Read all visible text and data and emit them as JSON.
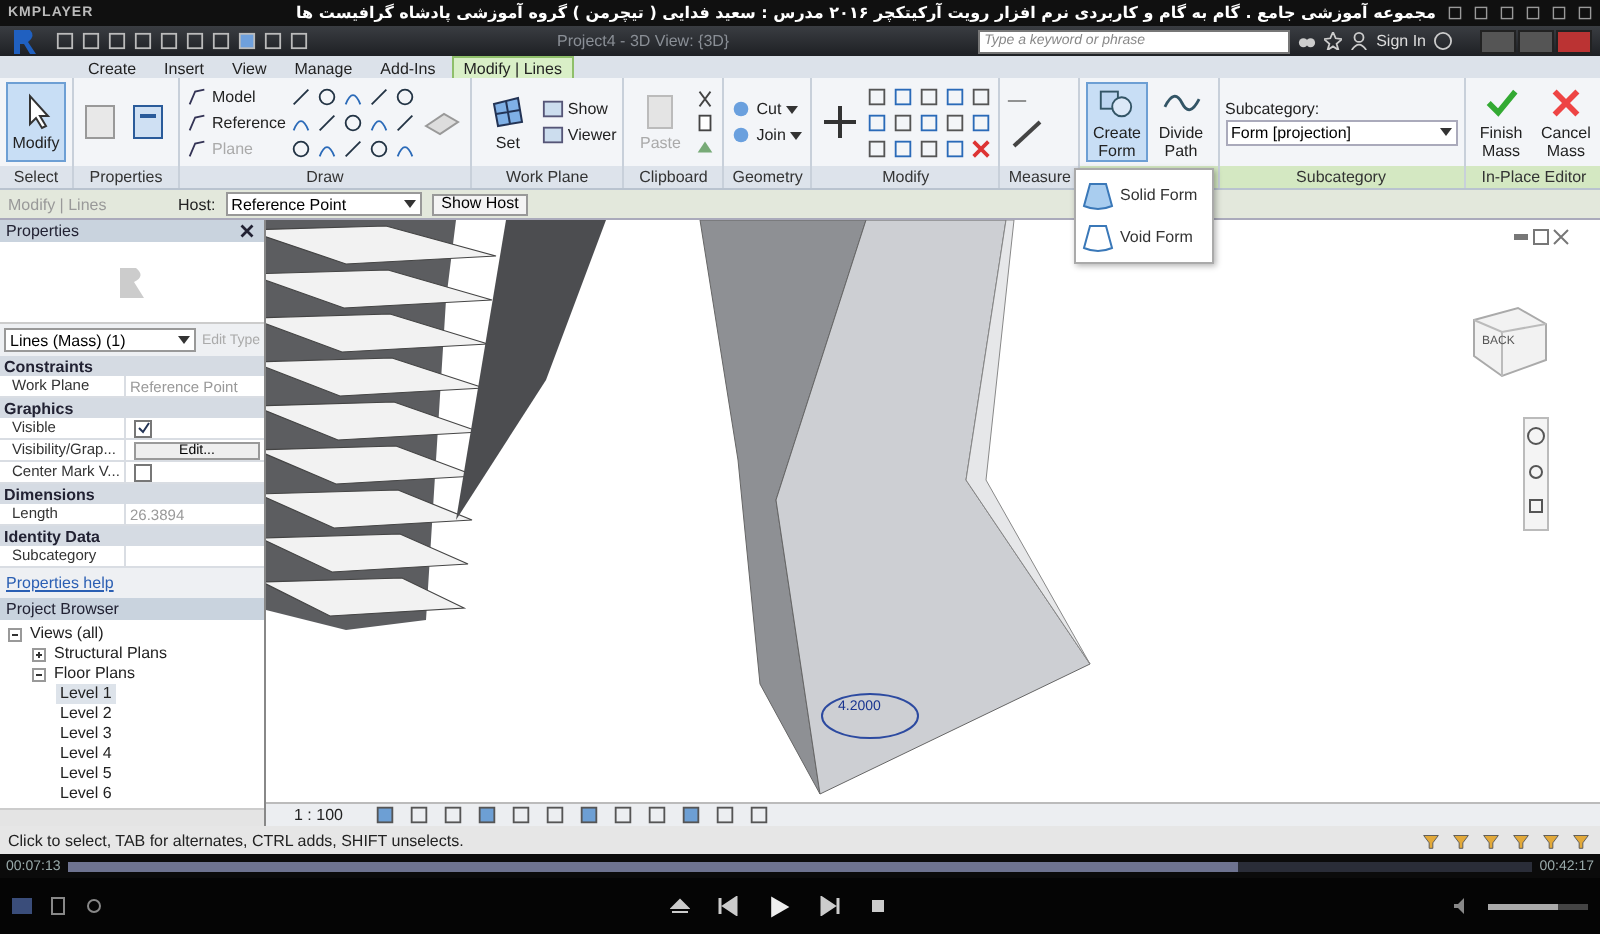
{
  "player": {
    "brand": "KMPLAYER",
    "title": "مجموعه آموزشی جامع . گام به گام و کاربردی نرم افزار رویت آرکیتکچر ۲۰۱۶   مدرس : سعید فدایی ( تیچرمن ) گروه آموزشی پادشاه گرافیست ها",
    "elapsed": "00:07:13",
    "total": "00:42:17",
    "level": 0.8,
    "volume": {
      "level": 0.7
    }
  },
  "app": {
    "title": "Project4 - 3D View: {3D}",
    "search_placeholder": "Type a keyword or phrase",
    "sign_in": "Sign In"
  },
  "tabs": [
    {
      "label": "Create",
      "selected": false
    },
    {
      "label": "Insert",
      "selected": false
    },
    {
      "label": "View",
      "selected": false
    },
    {
      "label": "Manage",
      "selected": false
    },
    {
      "label": "Add-Ins",
      "selected": false
    },
    {
      "label": "Modify | Lines",
      "selected": true
    }
  ],
  "ribbon": [
    {
      "kind": "select",
      "label": "Select",
      "buttons": [
        {
          "label": "Modify",
          "selected": true
        }
      ]
    },
    {
      "kind": "properties",
      "label": "Properties"
    },
    {
      "kind": "draw",
      "label": "Draw",
      "buttons": [
        {
          "label": "Model",
          "disabled": false
        },
        {
          "label": "Reference",
          "disabled": false
        },
        {
          "label": "Plane",
          "disabled": true
        }
      ]
    },
    {
      "kind": "work_plane",
      "label": "Work Plane",
      "buttons": [
        {
          "label": "Set"
        },
        {
          "label": "Show"
        },
        {
          "label": "Viewer"
        }
      ]
    },
    {
      "kind": "clipboard",
      "label": "Clipboard",
      "buttons": [
        {
          "label": "Paste",
          "disabled": true
        }
      ]
    },
    {
      "kind": "geometry",
      "label": "Geometry",
      "buttons": [
        {
          "label": "Cut"
        },
        {
          "label": "Join"
        }
      ]
    },
    {
      "kind": "modify",
      "label": "Modify"
    },
    {
      "kind": "measure",
      "label": "Measure"
    },
    {
      "kind": "form",
      "buttons": [
        {
          "label": "Create Form",
          "selected": true
        },
        {
          "label": "Divide Path",
          "selected": false
        }
      ]
    },
    {
      "kind": "subcategory",
      "label": "Subcategory",
      "field_label": "Subcategory:",
      "value": "Form [projection]"
    },
    {
      "kind": "editor",
      "label": "In-Place Editor",
      "buttons": [
        {
          "label": "Finish Mass"
        },
        {
          "label": "Cancel Mass"
        }
      ]
    }
  ],
  "form_menu": [
    {
      "label": "Solid Form",
      "kind": "solid"
    },
    {
      "label": "Void Form",
      "kind": "void"
    }
  ],
  "options_bar": {
    "context": "Modify | Lines",
    "host_label": "Host:",
    "host_value": "Reference Point",
    "button": "Show Host"
  },
  "properties": {
    "title": "Properties",
    "type": "Lines (Mass) (1)",
    "edit_type": "Edit Type",
    "groups": [
      {
        "name": "Constraints",
        "rows": [
          {
            "label": "Work Plane",
            "kind": "text",
            "value": "Reference Point",
            "disabled": true
          }
        ]
      },
      {
        "name": "Graphics",
        "rows": [
          {
            "label": "Visible",
            "kind": "checkbox",
            "checked": true
          },
          {
            "label": "Visibility/Grap...",
            "kind": "button",
            "value": "Edit..."
          },
          {
            "label": "Center Mark V...",
            "kind": "checkbox",
            "checked": false
          }
        ]
      },
      {
        "name": "Dimensions",
        "rows": [
          {
            "label": "Length",
            "kind": "text",
            "value": "26.3894",
            "disabled": true
          }
        ]
      },
      {
        "name": "Identity Data",
        "rows": [
          {
            "label": "Subcategory",
            "kind": "empty"
          }
        ]
      }
    ],
    "help": "Properties help"
  },
  "browser": {
    "title": "Project Browser",
    "tree": [
      {
        "label": "Views (all)",
        "expanded": true,
        "selected": false,
        "children": [
          {
            "label": "Structural Plans",
            "expanded": false,
            "selected": false
          },
          {
            "label": "Floor Plans",
            "expanded": true,
            "selected": false,
            "children": [
              {
                "label": "Level 1",
                "selected": true
              },
              {
                "label": "Level 2",
                "selected": false
              },
              {
                "label": "Level 3",
                "selected": false
              },
              {
                "label": "Level 4",
                "selected": false
              },
              {
                "label": "Level 5",
                "selected": false
              },
              {
                "label": "Level 6",
                "selected": false
              }
            ]
          }
        ]
      }
    ]
  },
  "canvas": {
    "dimension": "4.2000",
    "view_cube": "BACK",
    "scale": "1 : 100"
  },
  "status_bar": {
    "text": "Click to select, TAB for alternates, CTRL adds, SHIFT unselects."
  }
}
